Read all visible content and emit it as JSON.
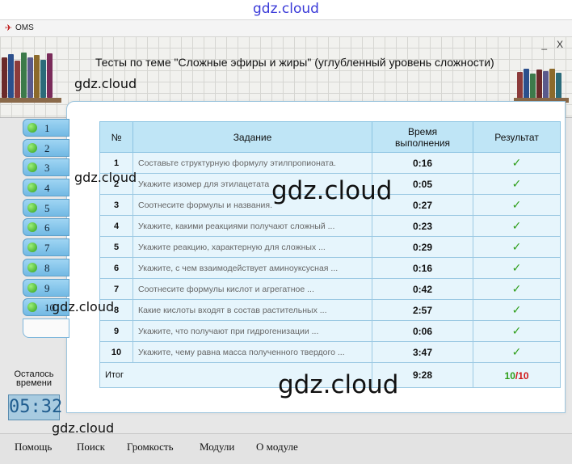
{
  "watermark": "gdz.cloud",
  "window": {
    "app_name": "OMS",
    "minimize": "_",
    "close": "X"
  },
  "page_title": "Тесты по теме \"Сложные эфиры и жиры\" (углубленный уровень сложности)",
  "sidebar": {
    "items": [
      "1",
      "2",
      "3",
      "4",
      "5",
      "6",
      "7",
      "8",
      "9",
      "10"
    ]
  },
  "table": {
    "headers": {
      "num": "№",
      "task": "Задание",
      "time": "Время выполнения",
      "result": "Результат"
    },
    "rows": [
      {
        "num": "1",
        "task": "Составьте структурную формулу этилпропионата.",
        "time": "0:16",
        "result": "✓"
      },
      {
        "num": "2",
        "task": "Укажите изомер для этилацетата",
        "time": "0:05",
        "result": "✓"
      },
      {
        "num": "3",
        "task": "Соотнесите формулы и названия.",
        "time": "0:27",
        "result": "✓"
      },
      {
        "num": "4",
        "task": "Укажите, какими реакциями получают сложный ...",
        "time": "0:23",
        "result": "✓"
      },
      {
        "num": "5",
        "task": "Укажите реакцию, характерную для сложных ...",
        "time": "0:29",
        "result": "✓"
      },
      {
        "num": "6",
        "task": "Укажите, с чем взаимодействует аминоуксусная ...",
        "time": "0:16",
        "result": "✓"
      },
      {
        "num": "7",
        "task": "Соотнесите формулы кислот и агрегатное ...",
        "time": "0:42",
        "result": "✓"
      },
      {
        "num": "8",
        "task": "Какие кислоты входят в состав растительных ...",
        "time": "2:57",
        "result": "✓"
      },
      {
        "num": "9",
        "task": "Укажите, что получают при гидрогенизации ...",
        "time": "0:06",
        "result": "✓"
      },
      {
        "num": "10",
        "task": "Укажите, чему равна масса полученного твердого ...",
        "time": "3:47",
        "result": "✓"
      }
    ],
    "total": {
      "label": "Итог",
      "time": "9:28",
      "correct": "10",
      "separator": "/",
      "total": "10"
    }
  },
  "timer": {
    "label": "Осталось времени",
    "value": "05:32"
  },
  "menu": {
    "help": "Помощь",
    "search": "Поиск",
    "volume": "Громкость",
    "modules": "Модули",
    "about": "О модуле"
  },
  "colors": {
    "accent": "#72b9e4",
    "correct": "#2e9e1a",
    "total": "#d01818"
  }
}
